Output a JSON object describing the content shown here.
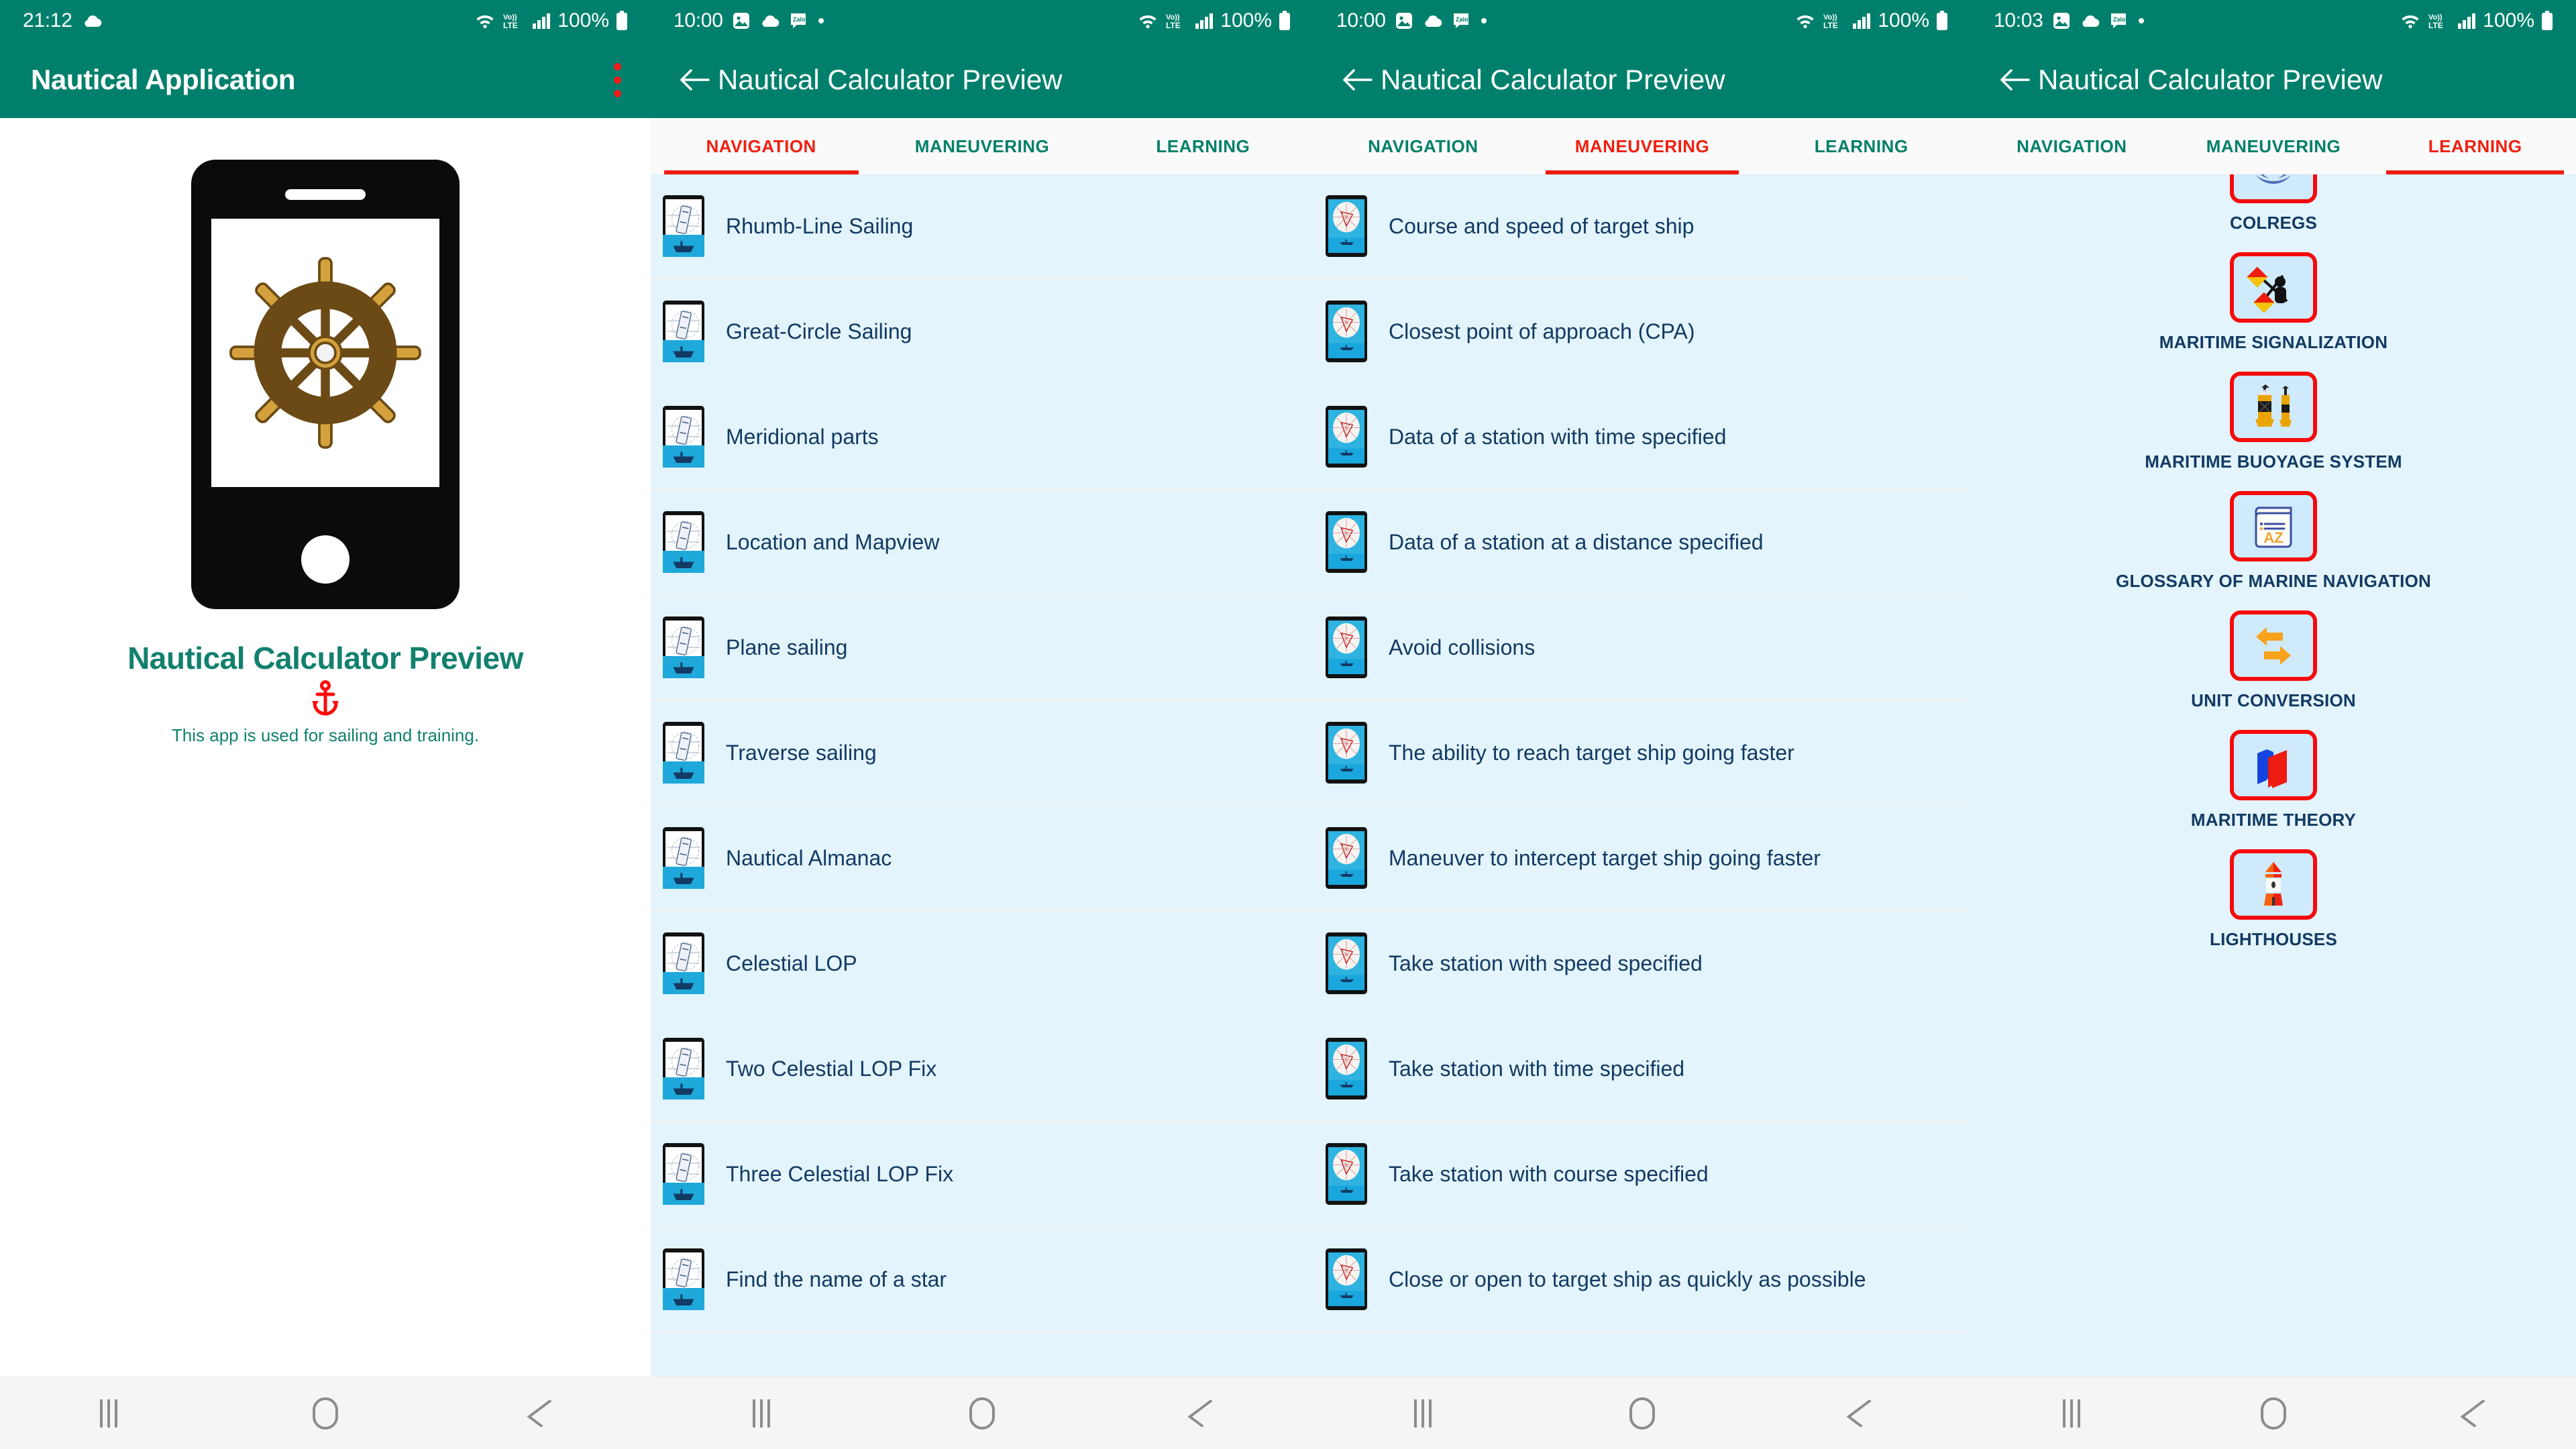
{
  "panels": [
    {
      "id": "home",
      "status": {
        "time": "21:12",
        "battery": "100%",
        "icons": [
          "cloud-icon",
          "wifi-icon",
          "volte-icon",
          "signal-icon",
          "battery-icon"
        ]
      },
      "appbar": {
        "title": "Nautical Application",
        "menu_icon": "overflow-menu-icon"
      },
      "home": {
        "illustration": "phone-with-ships-wheel-icon",
        "title": "Nautical Calculator Preview",
        "anchor_icon": "anchor-icon",
        "subtitle": "This app is used for sailing and training."
      }
    },
    {
      "id": "navigation",
      "status": {
        "time": "10:00",
        "battery": "100%",
        "icons": [
          "image-icon",
          "cloud-icon",
          "zalo-icon",
          "dot-icon",
          "wifi-icon",
          "volte-icon",
          "signal-icon",
          "battery-icon"
        ]
      },
      "appbar": {
        "title": "Nautical Calculator Preview",
        "back_icon": "back-arrow-icon"
      },
      "tabs": [
        {
          "label": "NAVIGATION",
          "active": true
        },
        {
          "label": "MANEUVERING",
          "active": false
        },
        {
          "label": "LEARNING",
          "active": false
        }
      ],
      "items": [
        {
          "label": "Rhumb-Line Sailing",
          "icon": "sextant-phone-icon"
        },
        {
          "label": "Great-Circle Sailing",
          "icon": "sextant-phone-icon"
        },
        {
          "label": "Meridional parts",
          "icon": "sextant-phone-icon"
        },
        {
          "label": "Location and Mapview",
          "icon": "sextant-phone-icon"
        },
        {
          "label": "Plane sailing",
          "icon": "sextant-phone-icon"
        },
        {
          "label": "Traverse sailing",
          "icon": "sextant-phone-icon"
        },
        {
          "label": "Nautical Almanac",
          "icon": "sextant-phone-icon"
        },
        {
          "label": "Celestial LOP",
          "icon": "sextant-phone-icon"
        },
        {
          "label": "Two Celestial LOP Fix",
          "icon": "sextant-phone-icon"
        },
        {
          "label": "Three Celestial LOP Fix",
          "icon": "sextant-phone-icon"
        },
        {
          "label": "Find the name of a star",
          "icon": "sextant-phone-icon"
        }
      ]
    },
    {
      "id": "maneuvering",
      "status": {
        "time": "10:00",
        "battery": "100%",
        "icons": [
          "image-icon",
          "cloud-icon",
          "zalo-icon",
          "dot-icon",
          "wifi-icon",
          "volte-icon",
          "signal-icon",
          "battery-icon"
        ]
      },
      "appbar": {
        "title": "Nautical Calculator Preview",
        "back_icon": "back-arrow-icon"
      },
      "tabs": [
        {
          "label": "NAVIGATION",
          "active": false
        },
        {
          "label": "MANEUVERING",
          "active": true
        },
        {
          "label": "LEARNING",
          "active": false
        }
      ],
      "items": [
        {
          "label": "Course and speed of target ship",
          "icon": "radar-phone-icon"
        },
        {
          "label": "Closest point of approach (CPA)",
          "icon": "radar-phone-icon"
        },
        {
          "label": "Data of a station with time specified",
          "icon": "radar-phone-icon"
        },
        {
          "label": "Data of a station at a distance specified",
          "icon": "radar-phone-icon"
        },
        {
          "label": "Avoid collisions",
          "icon": "radar-phone-icon"
        },
        {
          "label": "The ability to reach target ship going faster",
          "icon": "radar-phone-icon"
        },
        {
          "label": "Maneuver to intercept target ship going faster",
          "icon": "radar-phone-icon"
        },
        {
          "label": "Take station with speed specified",
          "icon": "radar-phone-icon"
        },
        {
          "label": "Take station with time specified",
          "icon": "radar-phone-icon"
        },
        {
          "label": "Take station with course specified",
          "icon": "radar-phone-icon"
        },
        {
          "label": "Close or open to target ship as quickly as possible",
          "icon": "radar-phone-icon"
        }
      ]
    },
    {
      "id": "learning",
      "status": {
        "time": "10:03",
        "battery": "100%",
        "icons": [
          "image-icon",
          "cloud-icon",
          "zalo-icon",
          "dot-icon",
          "wifi-icon",
          "volte-icon",
          "signal-icon",
          "battery-icon"
        ]
      },
      "appbar": {
        "title": "Nautical Calculator Preview",
        "back_icon": "back-arrow-icon"
      },
      "tabs": [
        {
          "label": "NAVIGATION",
          "active": false
        },
        {
          "label": "MANEUVERING",
          "active": false
        },
        {
          "label": "LEARNING",
          "active": true
        }
      ],
      "items": [
        {
          "label": "COLREGS",
          "icon": "imo-wreath-icon",
          "clipped": true
        },
        {
          "label": "MARITIME SIGNALIZATION",
          "icon": "semaphore-flags-icon",
          "clipped": false
        },
        {
          "label": "MARITIME BUOYAGE SYSTEM",
          "icon": "buoys-icon",
          "clipped": false
        },
        {
          "label": "GLOSSARY OF MARINE NAVIGATION",
          "icon": "az-dictionary-icon",
          "clipped": false
        },
        {
          "label": "UNIT CONVERSION",
          "icon": "exchange-arrows-icon",
          "clipped": false
        },
        {
          "label": "MARITIME THEORY",
          "icon": "books-icon",
          "clipped": false
        },
        {
          "label": "LIGHTHOUSES",
          "icon": "lighthouse-icon",
          "clipped": false
        }
      ]
    }
  ],
  "navbar": {
    "recents": "recents-icon",
    "home": "home-icon",
    "back": "back-icon"
  },
  "colors": {
    "teal": "#00806c",
    "accent_red": "#ee1c0f",
    "list_bg": "#e3f4fc",
    "label_navy": "#123a63",
    "tab_green": "#028068"
  }
}
